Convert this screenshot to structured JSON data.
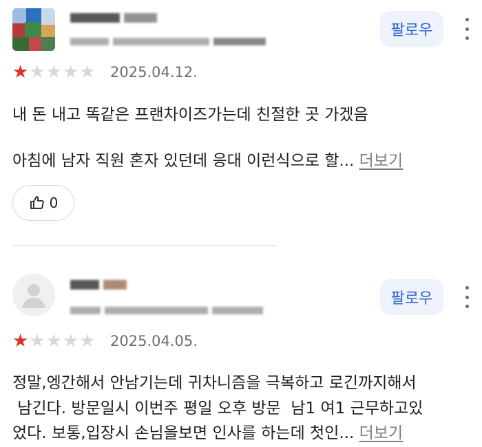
{
  "reviews": [
    {
      "follow_label": "팔로우",
      "rating": 1,
      "max_rating": 5,
      "date": "2025.04.12.",
      "text_line1": "내 돈 내고 똑같은 프랜차이즈가는데 친절한 곳 가겠음",
      "text_line2": "아침에 남자 직원 혼자 있던데 응대 이런식으로 할...",
      "more_label": "더보기",
      "like_count": "0"
    },
    {
      "follow_label": "팔로우",
      "rating": 1,
      "max_rating": 5,
      "date": "2025.04.05.",
      "text_line1": "정말,엥간해서 안남기는데 귀차니즘을 극복하고 로긴까지해서",
      "text_line2": " 남긴다. 방문일시 이번주 평일 오후 방문  남1 여1 근무하고있",
      "text_line3": "었다. 보통,입장시 손님을보면 인사를 하는데 첫인...",
      "more_label": "더보기"
    }
  ],
  "icons": {
    "star": "star-icon",
    "thumbs_up": "thumbs-up-icon",
    "more_options": "kebab-menu-icon"
  },
  "colors": {
    "accent": "#2f64cf",
    "follow_bg": "#eef3fb",
    "star_filled": "#e0322b",
    "star_empty": "#d8d8d8"
  }
}
